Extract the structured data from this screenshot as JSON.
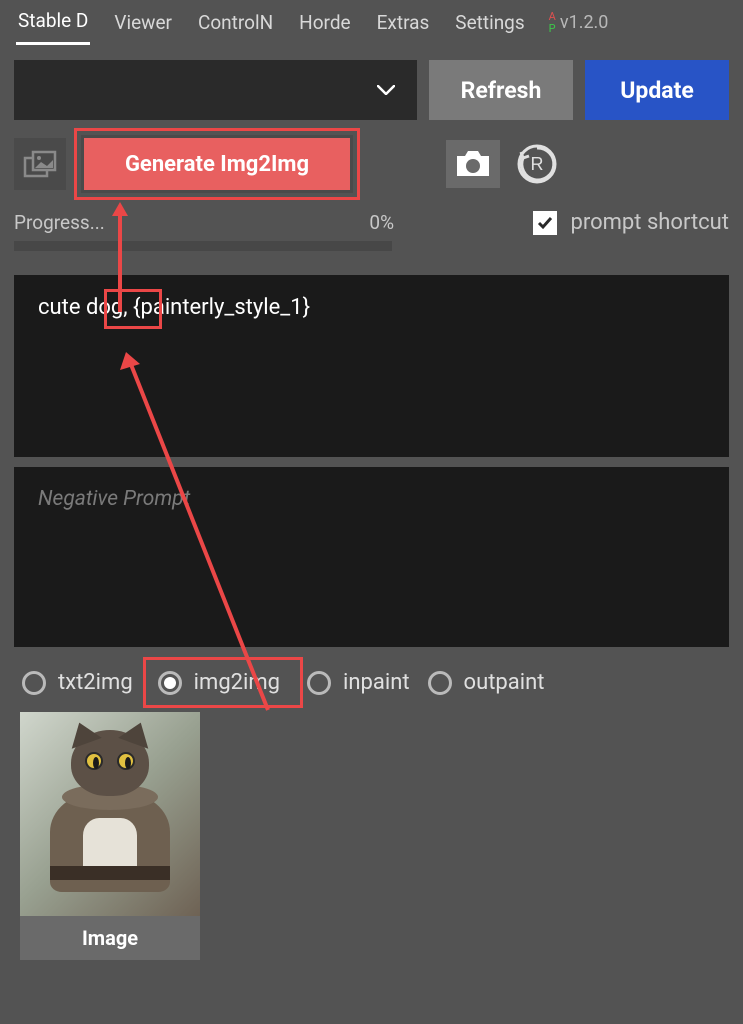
{
  "tabs": {
    "items": [
      "Stable D",
      "Viewer",
      "ControlN",
      "Horde",
      "Extras",
      "Settings"
    ],
    "active_index": 0
  },
  "version": {
    "text": "v1.2.0",
    "a": "A",
    "p": "P"
  },
  "buttons": {
    "refresh": "Refresh",
    "update": "Update",
    "generate": "Generate Img2Img"
  },
  "progress": {
    "label": "Progress...",
    "percent": "0%"
  },
  "shortcut": {
    "label": "prompt shortcut",
    "checked": true
  },
  "prompt": {
    "value": "cute dog, {painterly_style_1}"
  },
  "negative_prompt": {
    "placeholder": "Negative Prompt",
    "value": ""
  },
  "modes": {
    "options": [
      "txt2img",
      "img2img",
      "inpaint",
      "outpaint"
    ],
    "selected": "img2img"
  },
  "thumbnail": {
    "label": "Image"
  },
  "icons": {
    "layers": "layers-icon",
    "camera": "camera-icon",
    "reset": "reset-icon",
    "chevron": "chevron-down-icon"
  }
}
